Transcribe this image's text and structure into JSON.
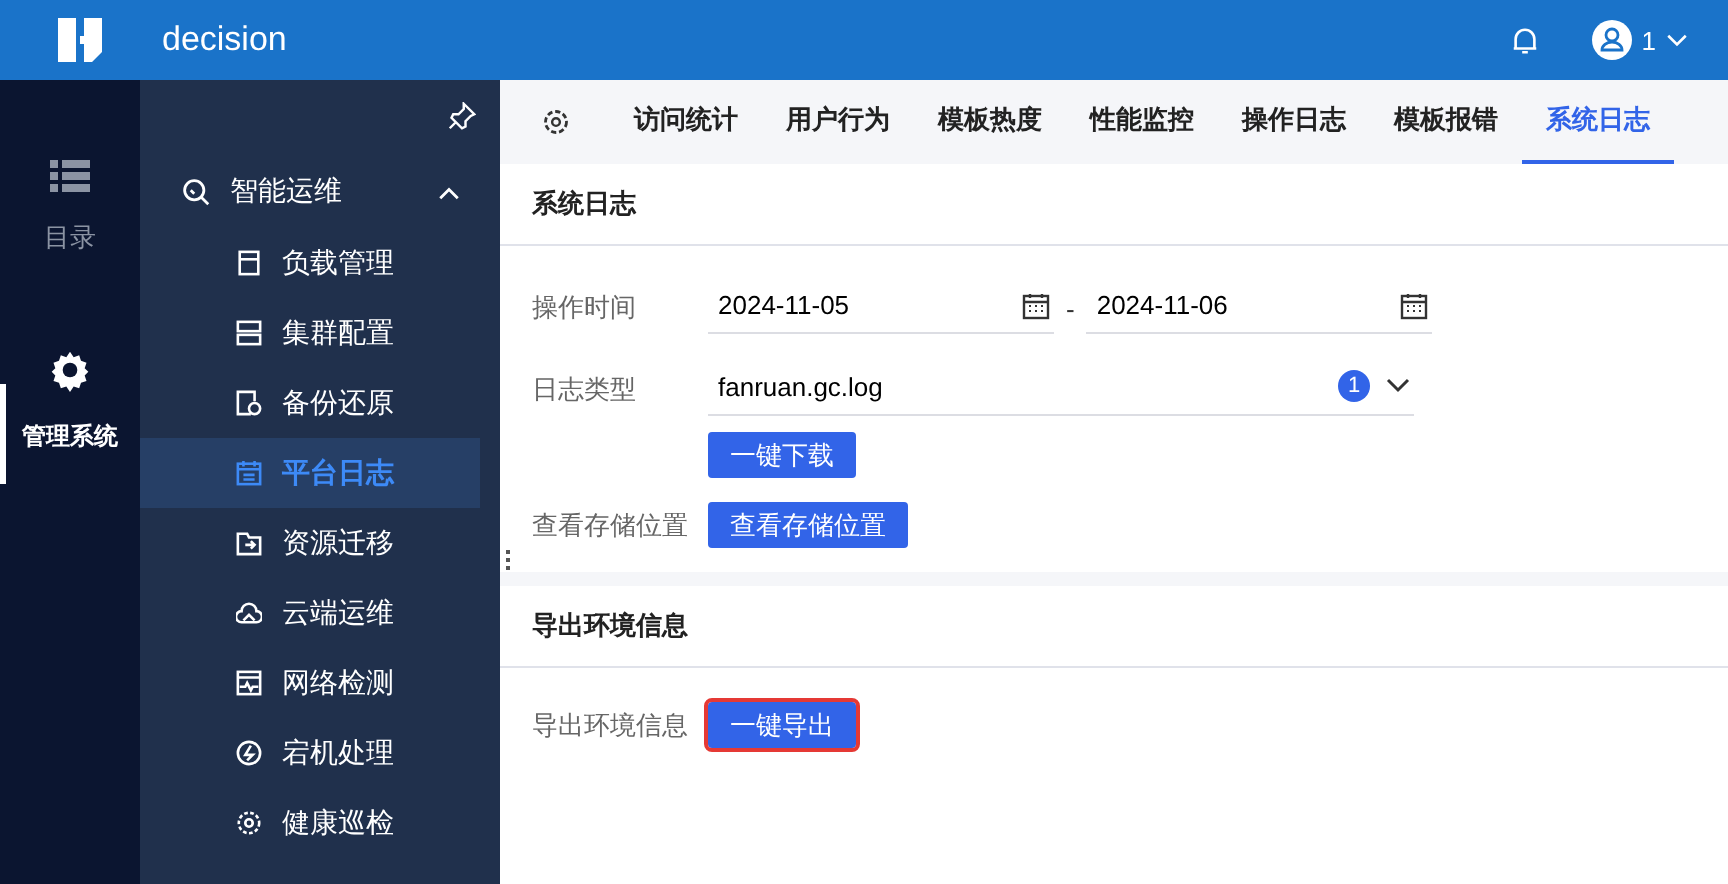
{
  "header": {
    "app_name": "decision",
    "user": "1"
  },
  "rail": [
    {
      "label": "目录",
      "kind": "list",
      "selected": false
    },
    {
      "label": "管理系统",
      "kind": "gear",
      "selected": true
    }
  ],
  "menu": {
    "group": "智能运维",
    "expanded": true,
    "items": [
      {
        "label": "负载管理",
        "kind": "card",
        "selected": false
      },
      {
        "label": "集群配置",
        "kind": "server",
        "selected": false
      },
      {
        "label": "备份还原",
        "kind": "backup",
        "selected": false
      },
      {
        "label": "平台日志",
        "kind": "calendar",
        "selected": true
      },
      {
        "label": "资源迁移",
        "kind": "folder",
        "selected": false
      },
      {
        "label": "云端运维",
        "kind": "cloud",
        "selected": false
      },
      {
        "label": "网络检测",
        "kind": "monitor",
        "selected": false
      },
      {
        "label": "宕机处理",
        "kind": "bolt",
        "selected": false
      },
      {
        "label": "健康巡检",
        "kind": "gear",
        "selected": false
      }
    ]
  },
  "tabs": [
    {
      "label": "访问统计",
      "selected": false
    },
    {
      "label": "用户行为",
      "selected": false
    },
    {
      "label": "模板热度",
      "selected": false
    },
    {
      "label": "性能监控",
      "selected": false
    },
    {
      "label": "操作日志",
      "selected": false
    },
    {
      "label": "模板报错",
      "selected": false
    },
    {
      "label": "系统日志",
      "selected": true
    }
  ],
  "log_section": {
    "title": "系统日志",
    "time_label": "操作时间",
    "date_from": "2024-11-05",
    "separator": "-",
    "date_to": "2024-11-06",
    "type_label": "日志类型",
    "type_value": "fanruan.gc.log",
    "type_count": "1",
    "download_button": "一键下载",
    "storage_label": "查看存储位置",
    "storage_button": "查看存储位置"
  },
  "export_section": {
    "title": "导出环境信息",
    "label": "导出环境信息",
    "button": "一键导出",
    "highlighted": true
  }
}
